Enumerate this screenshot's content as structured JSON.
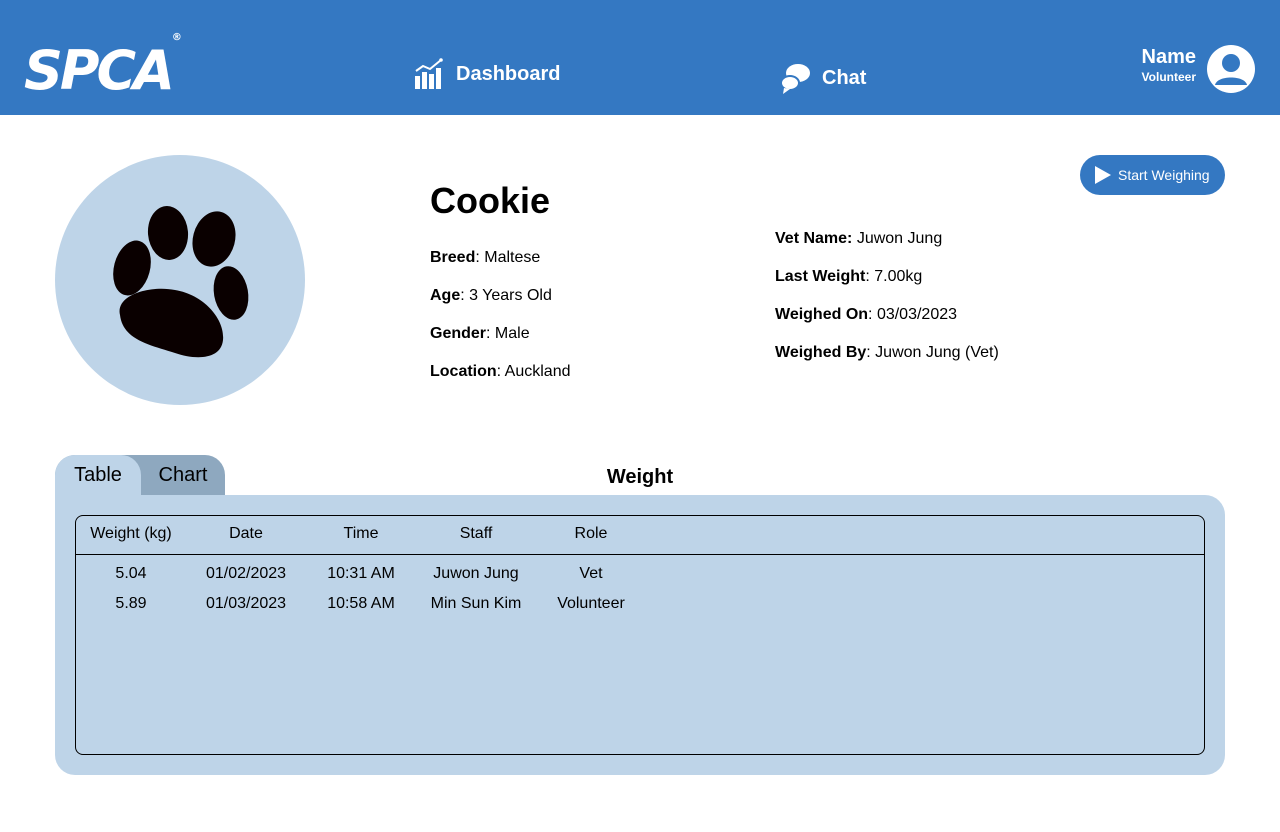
{
  "header": {
    "logo": "SPCA",
    "logo_mark": "®",
    "nav": [
      {
        "label": "Dashboard",
        "icon": "bar-chart-icon"
      },
      {
        "label": "Chat",
        "icon": "chat-bubbles-icon"
      }
    ],
    "user": {
      "name": "Name",
      "role": "Volunteer",
      "icon": "user-avatar-icon"
    }
  },
  "profile": {
    "name": "Cookie",
    "photo_icon": "paw-print-icon",
    "details_left": [
      {
        "label": "Breed",
        "value": ": Maltese"
      },
      {
        "label": "Age",
        "value": ": 3 Years Old"
      },
      {
        "label": "Gender",
        "value": ": Male"
      },
      {
        "label": "Location",
        "value": ": Auckland"
      }
    ],
    "details_right": [
      {
        "label": "Vet Name:",
        "value": " Juwon Jung"
      },
      {
        "label": "Last Weight",
        "value": ": 7.00kg"
      },
      {
        "label": "Weighed On",
        "value": ": 03/03/2023"
      },
      {
        "label": "Weighed By",
        "value": ": Juwon Jung (Vet)"
      }
    ],
    "start_button": "Start Weighing"
  },
  "weights": {
    "tabs": [
      "Table",
      "Chart"
    ],
    "active_tab": "Table",
    "title": "Weight",
    "columns": [
      "Weight (kg)",
      "Date",
      "Time",
      "Staff",
      "Role"
    ],
    "rows": [
      [
        "5.04",
        "01/02/2023",
        "10:31 AM",
        "Juwon Jung",
        "Vet"
      ],
      [
        "5.89",
        "01/03/2023",
        "10:58 AM",
        "Min Sun Kim",
        "Volunteer"
      ]
    ]
  },
  "colors": {
    "header_bg": "#3478c2",
    "panel_bg": "#bed4e8",
    "inactive_tab": "#8ea8bf"
  }
}
